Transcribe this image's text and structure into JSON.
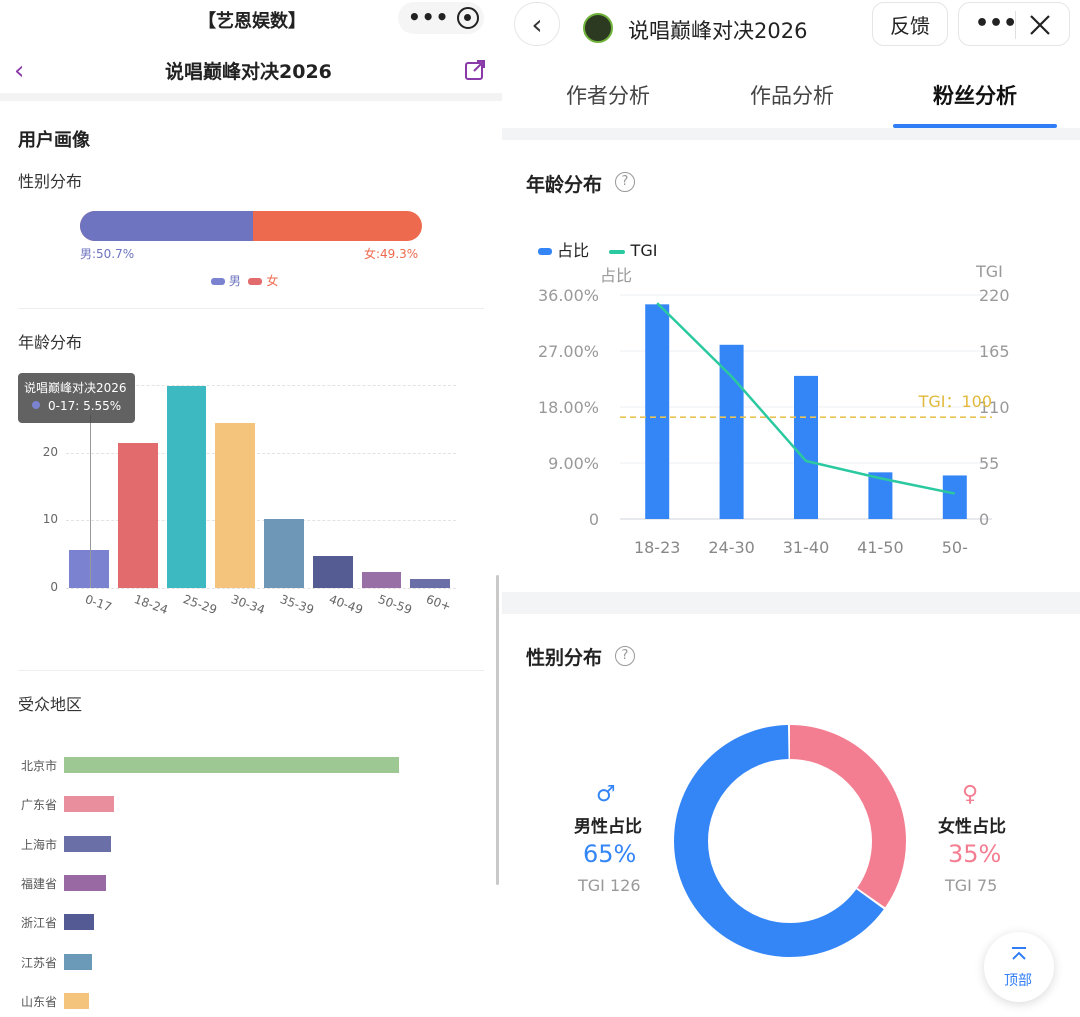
{
  "left": {
    "top_title": "【艺恩娱数】",
    "page_title": "说唱巅峰对决2026",
    "section_title": "用户画像",
    "gender": {
      "title": "性别分布",
      "male_label": "男:50.7%",
      "female_label": "女:49.3%",
      "male_fraction": 0.507,
      "legend_male": "男",
      "legend_female": "女",
      "male_color": "#6E74C0",
      "female_color": "#EE6A4F"
    },
    "age": {
      "title": "年龄分布",
      "tooltip_title": "说唱巅峰对决2026",
      "tooltip_value": "0-17: 5.55%",
      "y_ticks": [
        "0",
        "10",
        "20"
      ]
    },
    "region": {
      "title": "受众地区"
    }
  },
  "right": {
    "window_title": "说唱巅峰对决2026",
    "feedback_label": "反馈",
    "tabs": [
      "作者分析",
      "作品分析",
      "粉丝分析"
    ],
    "active_tab": 2,
    "age": {
      "title": "年龄分布",
      "legend_share": "占比",
      "legend_tgi": "TGI",
      "axis_left_title": "占比",
      "axis_right_title": "TGI",
      "left_ticks": [
        "0",
        "9.00%",
        "18.00%",
        "27.00%",
        "36.00%"
      ],
      "right_ticks": [
        "0",
        "55",
        "110",
        "165",
        "220"
      ],
      "tgi_reference_label": "TGI：100"
    },
    "gender": {
      "title": "性别分布",
      "male_title": "男性占比",
      "male_value": "65%",
      "male_tgi": "TGI 126",
      "female_title": "女性占比",
      "female_value": "35%",
      "female_tgi": "TGI 75",
      "male_share": 0.65,
      "male_color": "#3486F7",
      "female_color": "#F47E91"
    },
    "top_button_label": "顶部"
  },
  "chart_data": [
    {
      "type": "bar",
      "title": "年龄分布",
      "categories": [
        "0-17",
        "18-24",
        "25-29",
        "30-34",
        "35-39",
        "40-49",
        "50-59",
        "60+"
      ],
      "values": [
        5.55,
        21.5,
        29.9,
        24.4,
        10.2,
        4.8,
        2.4,
        1.4
      ],
      "colors": [
        "#7B83D0",
        "#E26B6D",
        "#3DB9C2",
        "#F4C47C",
        "#6E96B7",
        "#555C93",
        "#9870A5",
        "#6A6FA8"
      ],
      "ylim": [
        0,
        30
      ],
      "grid": true
    },
    {
      "type": "bar",
      "title": "受众地区",
      "orientation": "horizontal",
      "categories": [
        "北京市",
        "广东省",
        "上海市",
        "福建省",
        "浙江省",
        "江苏省",
        "山东省"
      ],
      "values": [
        100,
        15,
        14,
        12.5,
        9,
        8.5,
        7.5
      ],
      "colors": [
        "#9DC793",
        "#E88E9D",
        "#6A6FA8",
        "#9869A3",
        "#545A93",
        "#6B9AB8",
        "#F4C47C"
      ]
    },
    {
      "type": "bar",
      "title": "年龄分布",
      "categories": [
        "18-23",
        "24-30",
        "31-40",
        "41-50",
        "50-"
      ],
      "series": [
        {
          "name": "占比",
          "type": "bar",
          "axis": "left",
          "values": [
            34.5,
            28.0,
            23.0,
            7.5,
            7.0
          ],
          "color": "#3486F7"
        },
        {
          "name": "TGI",
          "type": "line",
          "axis": "right",
          "values": [
            212,
            140,
            57,
            40,
            25
          ],
          "color": "#2BC9A0"
        }
      ],
      "ylim_left": [
        0,
        36
      ],
      "ylim_right": [
        0,
        220
      ],
      "reference_line": {
        "axis": "right",
        "value": 100,
        "label": "TGI：100"
      },
      "grid": true,
      "legend": "top-left"
    },
    {
      "type": "pie",
      "title": "性别分布",
      "labels": [
        "男性占比",
        "女性占比"
      ],
      "values": [
        65,
        35
      ],
      "colors": [
        "#3486F7",
        "#F47E91"
      ],
      "donut": true
    }
  ]
}
